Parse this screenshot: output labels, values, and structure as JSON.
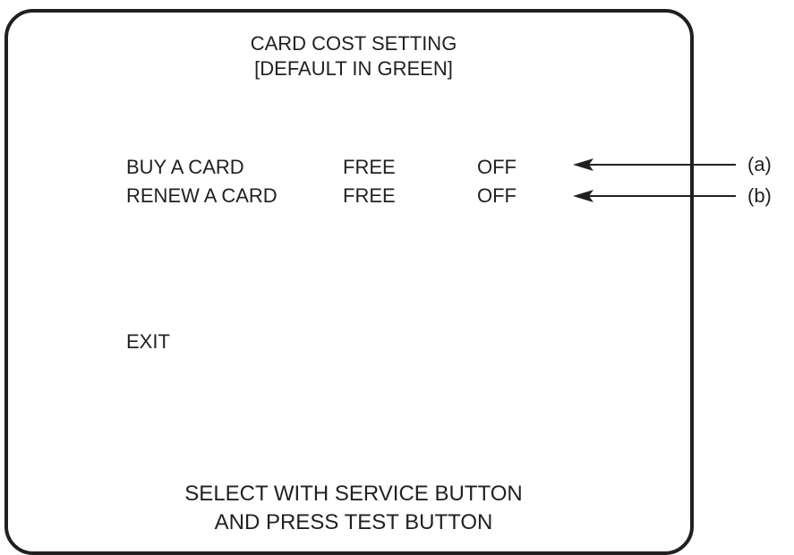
{
  "screen": {
    "title_line1": "CARD COST SETTING",
    "title_line2": "[DEFAULT IN GREEN]",
    "rows": [
      {
        "label": "BUY A CARD",
        "cost": "FREE",
        "status": "OFF",
        "callout": "(a)"
      },
      {
        "label": "RENEW A CARD",
        "cost": "FREE",
        "status": "OFF",
        "callout": "(b)"
      }
    ],
    "exit_label": "EXIT",
    "footer_line1": "SELECT WITH SERVICE BUTTON",
    "footer_line2": "AND PRESS TEST BUTTON"
  },
  "colors": {
    "ink": "#231f20",
    "background": "#ffffff"
  }
}
